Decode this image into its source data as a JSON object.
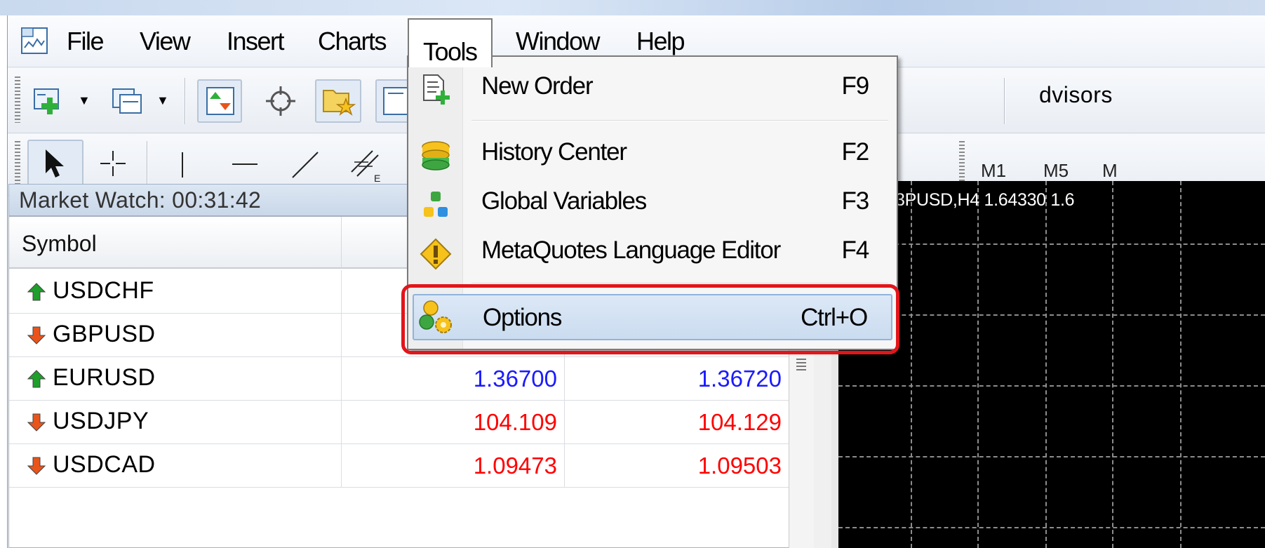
{
  "menubar": {
    "items": [
      {
        "label": "File"
      },
      {
        "label": "View"
      },
      {
        "label": "Insert"
      },
      {
        "label": "Charts"
      },
      {
        "label": "Tools"
      },
      {
        "label": "Window"
      },
      {
        "label": "Help"
      }
    ],
    "active": "Tools"
  },
  "toolbar": {
    "advisors_label": "dvisors",
    "timeframes": [
      "M1",
      "M5",
      "M"
    ]
  },
  "market_watch": {
    "title": "Market Watch: 00:31:42",
    "column_symbol": "Symbol",
    "rows": [
      {
        "symbol": "USDCHF",
        "direction": "up",
        "bid": "",
        "ask": "",
        "color": "#000000"
      },
      {
        "symbol": "GBPUSD",
        "direction": "down",
        "bid": "",
        "ask": "",
        "color": "#000000"
      },
      {
        "symbol": "EURUSD",
        "direction": "up",
        "bid": "1.36700",
        "ask": "1.36720",
        "color": "#1a1aff"
      },
      {
        "symbol": "USDJPY",
        "direction": "down",
        "bid": "104.109",
        "ask": "104.129",
        "color": "#ff0000"
      },
      {
        "symbol": "USDCAD",
        "direction": "down",
        "bid": "1.09473",
        "ask": "1.09503",
        "color": "#ff0000"
      }
    ]
  },
  "chart": {
    "title": "3PUSD,H4  1.64330 1.6"
  },
  "tools_menu": {
    "items": [
      {
        "label": "New Order",
        "shortcut": "F9",
        "icon": "new-order-icon"
      },
      {
        "label": "History Center",
        "shortcut": "F2",
        "icon": "history-center-icon"
      },
      {
        "label": "Global Variables",
        "shortcut": "F3",
        "icon": "global-variables-icon"
      },
      {
        "label": "MetaQuotes Language Editor",
        "shortcut": "F4",
        "icon": "metaeditor-icon"
      },
      {
        "label": "Options",
        "shortcut": "Ctrl+O",
        "icon": "options-icon",
        "highlighted": true
      }
    ]
  },
  "colors": {
    "highlight_border": "#e2151b",
    "up_arrow": "#1e9e2a",
    "down_arrow": "#e8541b",
    "price_up": "#1a1aff",
    "price_down": "#ff0000"
  }
}
